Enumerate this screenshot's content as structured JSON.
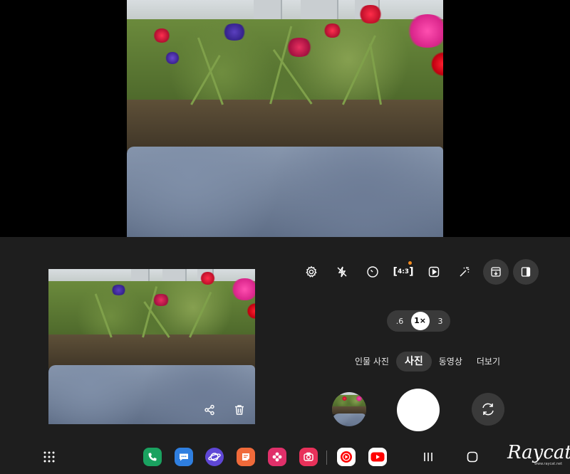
{
  "toolbar": {
    "aspect_ratio_label": "4:3",
    "accent_dot_color": "#f28a1e"
  },
  "zoom": {
    "options": [
      ".6",
      "1×",
      "3"
    ],
    "selected": "1×"
  },
  "modes": {
    "items": [
      "인물 사진",
      "사진",
      "동영상",
      "더보기"
    ],
    "selected": "사진"
  },
  "icons": {
    "toolbar": [
      "settings-icon",
      "flash-off-icon",
      "timer-icon",
      "aspect-ratio-icon",
      "motion-photo-icon",
      "filter-icon",
      "save-to-gallery-icon",
      "split-view-icon"
    ],
    "thumb_actions": [
      "share-icon",
      "delete-icon"
    ],
    "taskbar_apps": [
      "phone-icon",
      "messages-icon",
      "internet-icon",
      "notes-icon",
      "gallery-icon",
      "camera-icon",
      "youtube-music-icon",
      "youtube-icon"
    ],
    "nav": [
      "apps-grid-icon",
      "recents-icon",
      "home-icon"
    ]
  },
  "colors": {
    "panel_bg": "#1e1e1e",
    "pill_bg": "#3a3a3a",
    "phone": "#1aa260",
    "messages": "#2f7fe0",
    "internet": "#5f47d6",
    "notes": "#f06a3a",
    "gallery": "#e0306a",
    "camera": "#e8315a",
    "youtube": "#ff0000"
  },
  "watermark": {
    "text": "Raycat",
    "sub": "www.raycat.net"
  }
}
